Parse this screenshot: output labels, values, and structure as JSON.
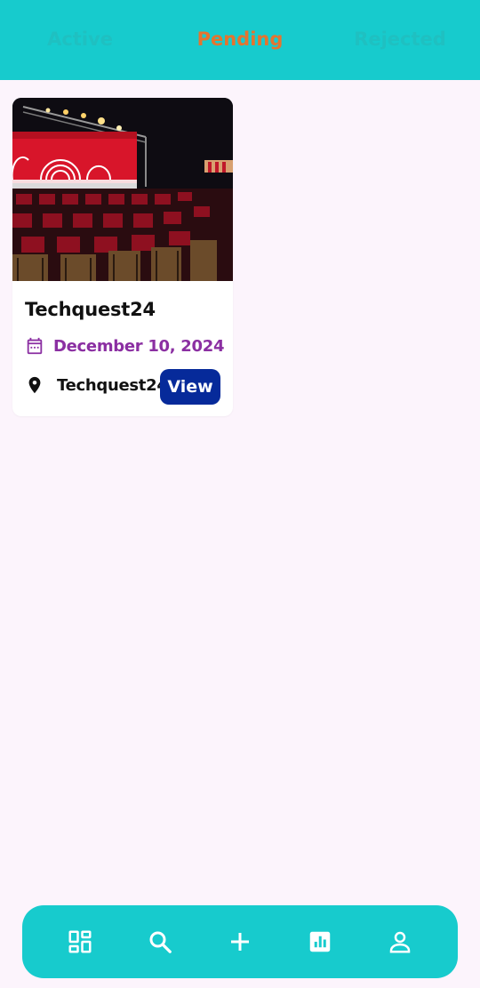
{
  "tabs": [
    {
      "label": "Active",
      "selected": false
    },
    {
      "label": "Pending",
      "selected": true
    },
    {
      "label": "Rejected",
      "selected": false
    }
  ],
  "colors": {
    "accent": "#17cbcd",
    "active_tab": "#e4742f",
    "date": "#8b2fa2",
    "button": "#062a9a",
    "background": "#fcf4fc"
  },
  "events": [
    {
      "title": "Techquest24",
      "date": "December 10, 2024",
      "location": "Techquest24",
      "view_label": "View",
      "image_icon": "event-stage-photo"
    }
  ],
  "bottom_nav": [
    {
      "icon": "dashboard-icon"
    },
    {
      "icon": "search-icon"
    },
    {
      "icon": "add-icon"
    },
    {
      "icon": "analytics-icon"
    },
    {
      "icon": "profile-icon"
    }
  ]
}
